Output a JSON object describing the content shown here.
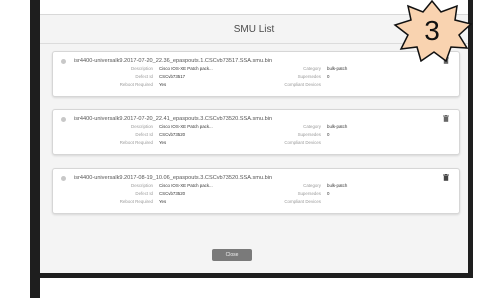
{
  "modal": {
    "title": "SMU List",
    "close_label": "Close"
  },
  "badge": {
    "number": "3",
    "color": "#f9d3b0",
    "outline": "#111111"
  },
  "labels": {
    "description": "Description",
    "defect_id": "Defect Id",
    "reboot_required": "Reboot Required",
    "category": "Category",
    "supersedes": "Supersedes",
    "compliant_devices": "Compliant Devices"
  },
  "items": [
    {
      "filename": "isr4400-universalk9.2017-07-20_22.36_epaspouts.1.CSCvb73517.SSA.smu.bin",
      "description": "Cisco IOS-XE Patch pack...",
      "defect_id": "CSCvb73517",
      "reboot_required": "Yes",
      "category": "bulk-patch",
      "supersedes": "0",
      "compliant_devices": ""
    },
    {
      "filename": "isr4400-universalk9.2017-07-20_22.41_epaspouts.3.CSCvb73520.SSA.smu.bin",
      "description": "Cisco IOS-XE Patch pack...",
      "defect_id": "CSCvb73520",
      "reboot_required": "Yes",
      "category": "bulk-patch",
      "supersedes": "0",
      "compliant_devices": ""
    },
    {
      "filename": "isr4400-universalk9.2017-08-19_10.06_epaspouts.3.CSCvb73520.SSA.smu.bin",
      "description": "Cisco IOS-XE Patch pack...",
      "defect_id": "CSCvb73520",
      "reboot_required": "Yes",
      "category": "bulk-patch",
      "supersedes": "0",
      "compliant_devices": ""
    }
  ]
}
